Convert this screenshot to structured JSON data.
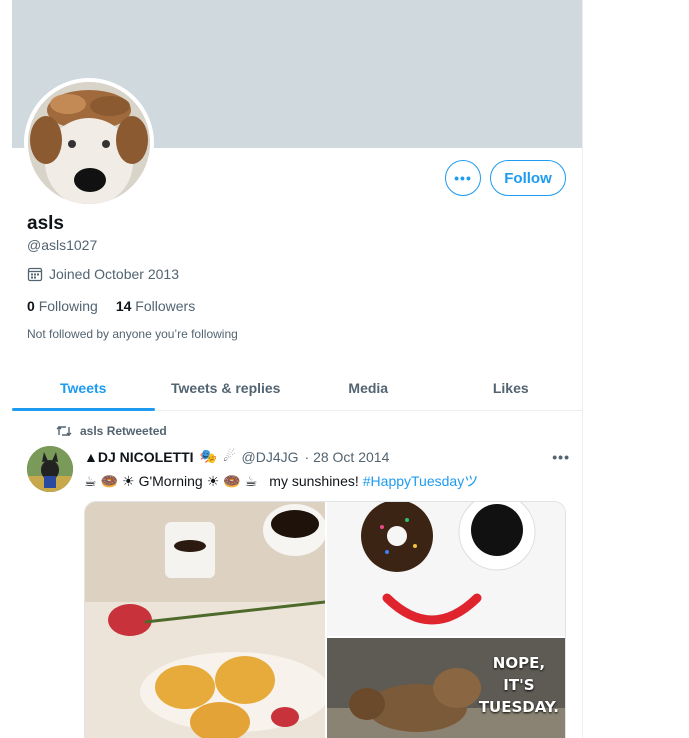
{
  "profile": {
    "name": "asls",
    "handle": "@asls1027",
    "joined": "Joined October 2013",
    "following_count": "0",
    "following_label": "Following",
    "followers_count": "14",
    "followers_label": "Followers",
    "not_followed": "Not followed by anyone you’re following"
  },
  "actions": {
    "more": "•••",
    "follow": "Follow"
  },
  "tabs": [
    {
      "label": "Tweets",
      "active": true
    },
    {
      "label": "Tweets & replies",
      "active": false
    },
    {
      "label": "Media",
      "active": false
    },
    {
      "label": "Likes",
      "active": false
    }
  ],
  "tweet": {
    "retweeted_by": "asls Retweeted",
    "author": "▲DJ NICOLETTI",
    "author_handle": "@DJ4JG",
    "date": "· 28 Oct 2014",
    "more": "•••",
    "text_main": "G'Morning",
    "text_sun": "my sunshines!",
    "hashtag": "#HappyTuesdayツ",
    "image_overlay": [
      "NOPE,",
      "IT'S",
      "TUESDAY."
    ]
  },
  "colors": {
    "accent": "#1d9bf0",
    "banner": "#cfd9de",
    "secondary_text": "#536471"
  }
}
